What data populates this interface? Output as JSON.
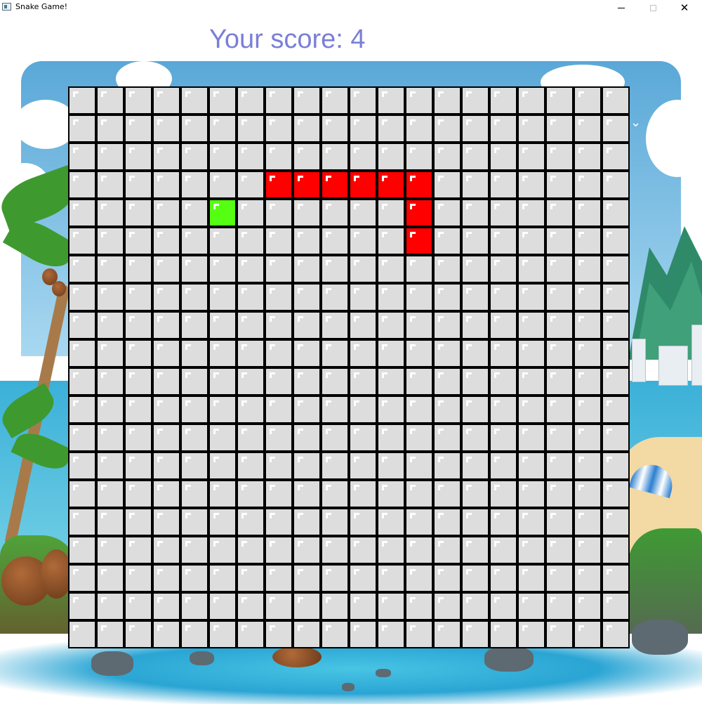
{
  "window": {
    "title": "Snake Game!",
    "icon": "app-icon",
    "controls": [
      "minimize-icon",
      "maximize-icon",
      "close-icon"
    ],
    "close_glyph": "✕"
  },
  "score": {
    "label": "Your score: 4",
    "color": "#7b7fd6"
  },
  "board": {
    "columns": 20,
    "rows": 20,
    "colors": {
      "empty": "#dddddd",
      "snake": "#ff0000",
      "food": "#55ff11",
      "grid_line": "#000000"
    },
    "snake": [
      {
        "col": 12,
        "row": 5
      },
      {
        "col": 12,
        "row": 4
      },
      {
        "col": 12,
        "row": 3
      },
      {
        "col": 11,
        "row": 3
      },
      {
        "col": 10,
        "row": 3
      },
      {
        "col": 9,
        "row": 3
      },
      {
        "col": 8,
        "row": 3
      },
      {
        "col": 7,
        "row": 3
      }
    ],
    "food": {
      "col": 5,
      "row": 4
    }
  }
}
